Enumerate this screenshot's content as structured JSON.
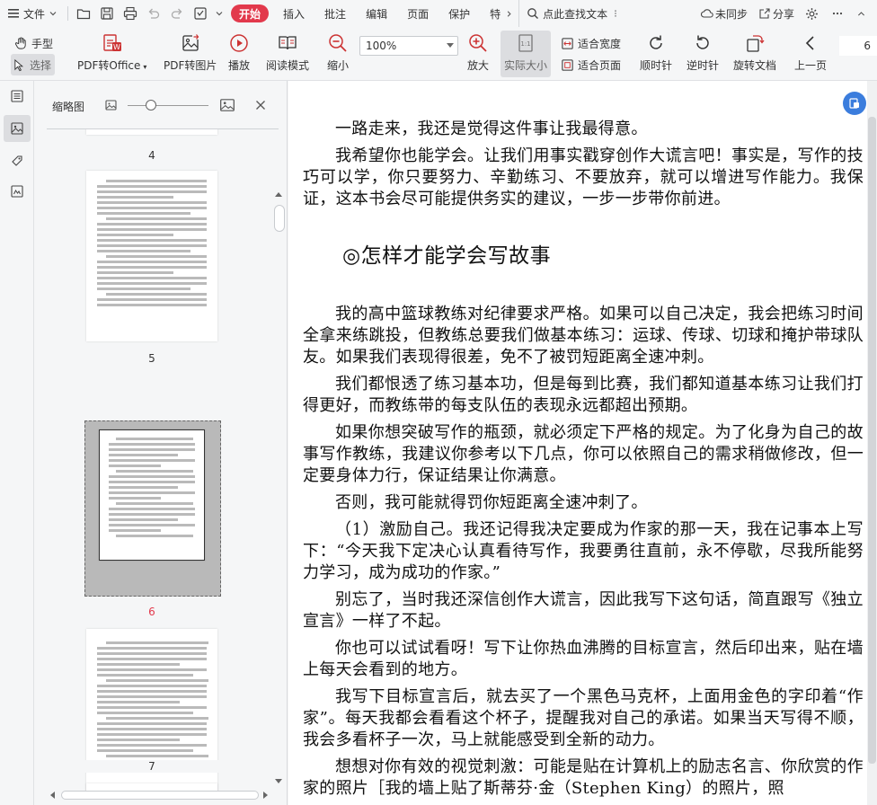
{
  "menubar": {
    "file_label": "文件",
    "tabs": [
      {
        "label": "开始",
        "active": true
      },
      {
        "label": "插入",
        "active": false
      },
      {
        "label": "批注",
        "active": false
      },
      {
        "label": "编辑",
        "active": false
      },
      {
        "label": "页面",
        "active": false
      },
      {
        "label": "保护",
        "active": false
      },
      {
        "label": "特",
        "active": false
      }
    ],
    "search_label": "点此查找文本",
    "sync_label": "未同步",
    "share_label": "分享"
  },
  "toolbar": {
    "hand_label": "手型",
    "select_label": "选择",
    "pdf_to_office": "PDF转Office",
    "pdf_to_image": "PDF转图片",
    "play": "播放",
    "read_mode": "阅读模式",
    "zoom_out": "缩小",
    "zoom_value": "100%",
    "zoom_in": "放大",
    "actual_size": "实际大小",
    "fit_width": "适合宽度",
    "fit_page": "适合页面",
    "rotate_cw": "顺时针",
    "rotate_ccw": "逆时针",
    "rotate_doc": "旋转文档",
    "prev_page": "上一页",
    "page_number": "6"
  },
  "thumbnail_panel": {
    "title": "缩略图",
    "pages": [
      {
        "number": "4",
        "current": false
      },
      {
        "number": "5",
        "current": false
      },
      {
        "number": "6",
        "current": true
      },
      {
        "number": "7",
        "current": false
      }
    ]
  },
  "document": {
    "paragraphs_before": [
      "一路走来，我还是觉得这件事让我最得意。",
      "我希望你也能学会。让我们用事实戳穿创作大谎言吧！事实是，写作的技巧可以学，你只要努力、辛勤练习、不要放弃，就可以增进写作能力。我保证，这本书会尽可能提供务实的建议，一步一步带你前进。"
    ],
    "heading": "◎怎样才能学会写故事",
    "paragraphs_after": [
      "我的高中篮球教练对纪律要求严格。如果可以自己决定，我会把练习时间全拿来练跳投，但教练总要我们做基本练习：运球、传球、切球和掩护带球队友。如果我们表现得很差，免不了被罚短距离全速冲刺。",
      "我们都恨透了练习基本功，但是每到比赛，我们都知道基本练习让我们打得更好，而教练带的每支队伍的表现永远都超出预期。",
      "如果你想突破写作的瓶颈，就必须定下严格的规定。为了化身为自己的故事写作教练，我建议你参考以下几点，你可以依照自己的需求稍做修改，但一定要身体力行，保证结果让你满意。",
      "否则，我可能就得罚你短距离全速冲刺了。",
      "（1）激励自己。我还记得我决定要成为作家的那一天，我在记事本上写下：“今天我下定决心认真看待写作，我要勇往直前，永不停歇，尽我所能努力学习，成为成功的作家。”",
      "别忘了，当时我还深信创作大谎言，因此我写下这句话，简直跟写《独立宣言》一样了不起。",
      "你也可以试试看呀！写下让你热血沸腾的目标宣言，然后印出来，贴在墙上每天会看到的地方。",
      "我写下目标宣言后，就去买了一个黑色马克杯，上面用金色的字印着“作家”。每天我都会看看这个杯子，提醒我对自己的承诺。如果当天写得不顺，我会多看杯子一次，马上就能感受到全新的动力。",
      "想想对你有效的视觉刺激：可能是贴在计算机上的励志名言、你欣赏的作家的照片［我的墙上贴了斯蒂芬·金（Stephen King）的照片，照"
    ]
  }
}
